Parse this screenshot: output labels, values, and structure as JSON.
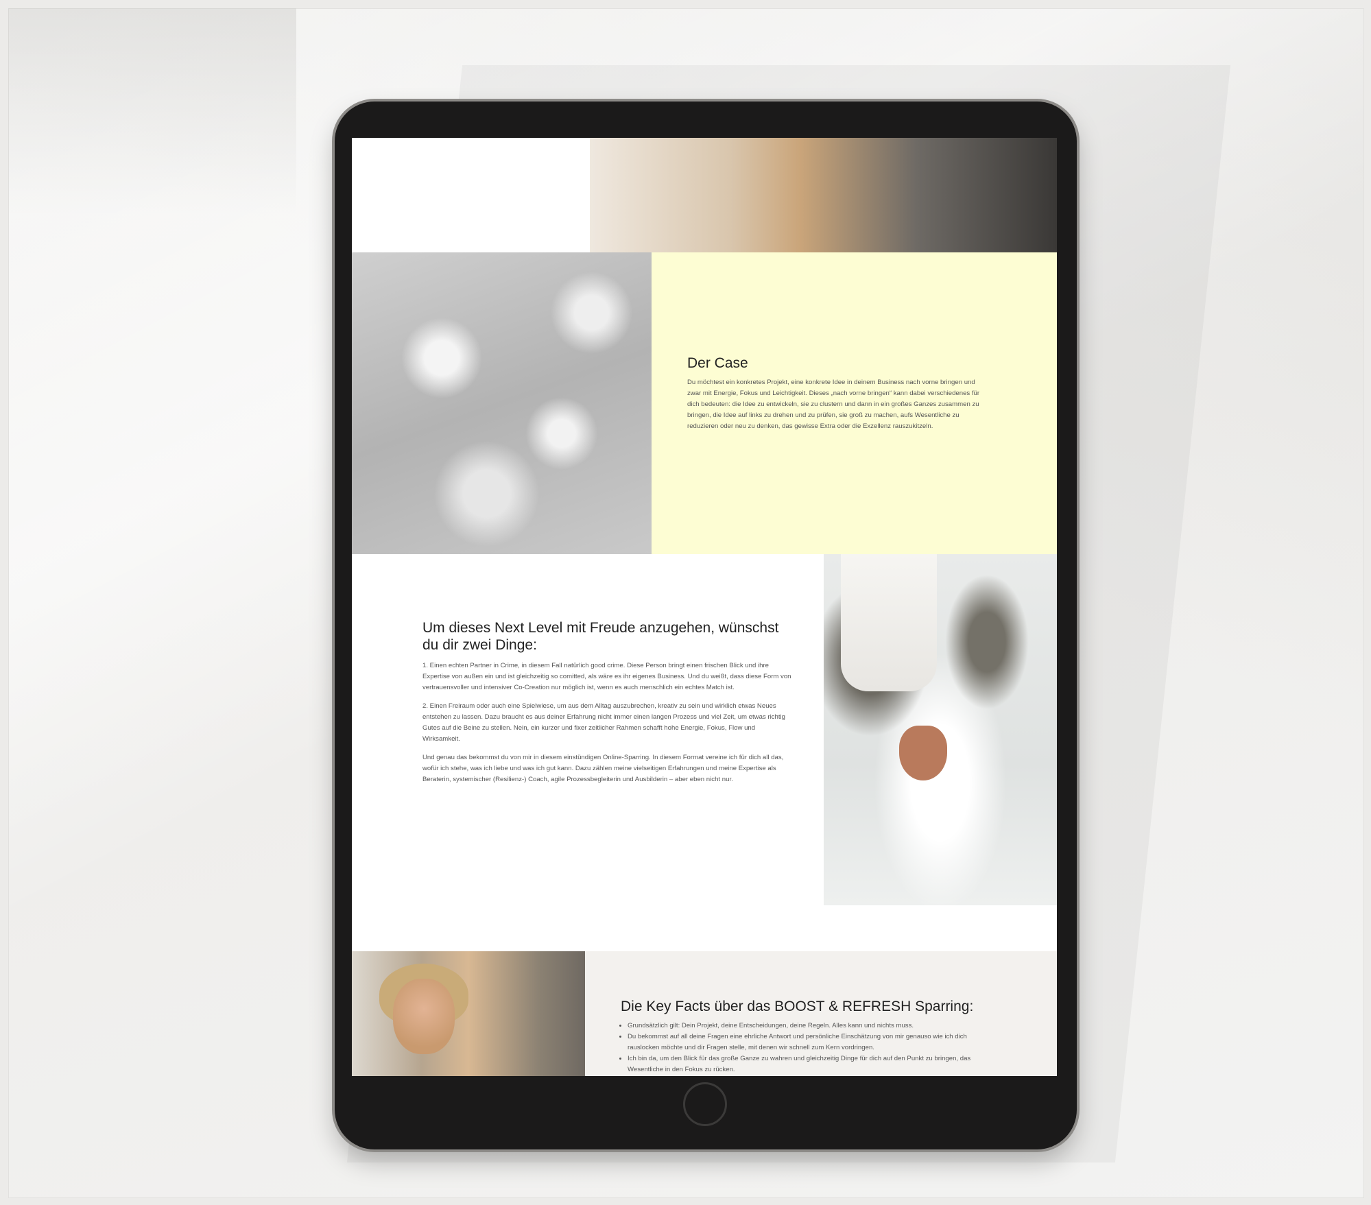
{
  "case": {
    "title": "Der Case",
    "body": "Du möchtest ein konkretes Projekt, eine konkrete Idee in deinem Business nach vorne bringen und zwar mit Energie, Fokus und Leichtigkeit. Dieses „nach vorne bringen“ kann dabei verschiedenes für dich bedeuten: die Idee zu entwickeln, sie zu clustern und dann in ein großes Ganzes zusammen zu bringen, die Idee auf links zu drehen und zu prüfen, sie groß zu machen, aufs Wesentliche zu reduzieren oder neu zu denken, das gewisse Extra oder die Exzellenz rauszukitzeln."
  },
  "next_level": {
    "title": "Um dieses Next Level mit Freude anzugehen, wünschst du dir zwei Dinge:",
    "paragraph_1": "1. Einen echten Partner in Crime, in diesem Fall natürlich good crime. Diese Person bringt einen frischen Blick und ihre Expertise von außen ein und ist gleichzeitig so comitted, als wäre es ihr eigenes Business. Und du weißt, dass diese Form von vertrauensvoller und intensiver Co-Creation nur möglich ist, wenn es auch menschlich ein echtes Match ist.",
    "paragraph_2": "2. Einen Freiraum oder auch eine Spielwiese, um aus dem Alltag auszubrechen, kreativ zu sein und wirklich etwas Neues entstehen zu lassen. Dazu braucht es aus deiner Erfahrung nicht immer einen langen Prozess und viel Zeit, um etwas richtig Gutes auf die Beine zu stellen. Nein, ein kurzer und fixer zeitlicher Rahmen schafft hohe Energie, Fokus, Flow und Wirksamkeit.",
    "paragraph_3": "Und genau das bekommst du von mir in diesem einstündigen Online-Sparring. In diesem Format vereine ich für dich all das, wofür ich stehe, was ich liebe und was ich gut kann. Dazu zählen meine vielseitigen Erfahrungen und meine Expertise als Beraterin, systemischer (Resilienz-) Coach, agile Prozessbegleiterin und Ausbilderin – aber eben nicht nur."
  },
  "key_facts": {
    "title": "Die Key Facts über das BOOST & REFRESH Sparring:",
    "items": [
      "Grundsätzlich gilt: Dein Projekt, deine Entscheidungen, deine Regeln. Alles kann und nichts muss.",
      "Du bekommst auf all deine Fragen eine ehrliche Antwort und persönliche Einschätzung von mir genauso wie ich dich rauslocken möchte und dir Fragen stelle, mit denen wir schnell zum Kern vordringen.",
      "Ich bin da, um den Blick für das große Ganze zu wahren und gleichzeitig Dinge für dich auf den Punkt zu bringen, das Wesentliche in den Fokus zu rücken."
    ]
  },
  "colors": {
    "case_panel": "#fdfdd3",
    "tablet_frame": "#1b1a1a",
    "bottom_band": "#f3f1ee"
  }
}
